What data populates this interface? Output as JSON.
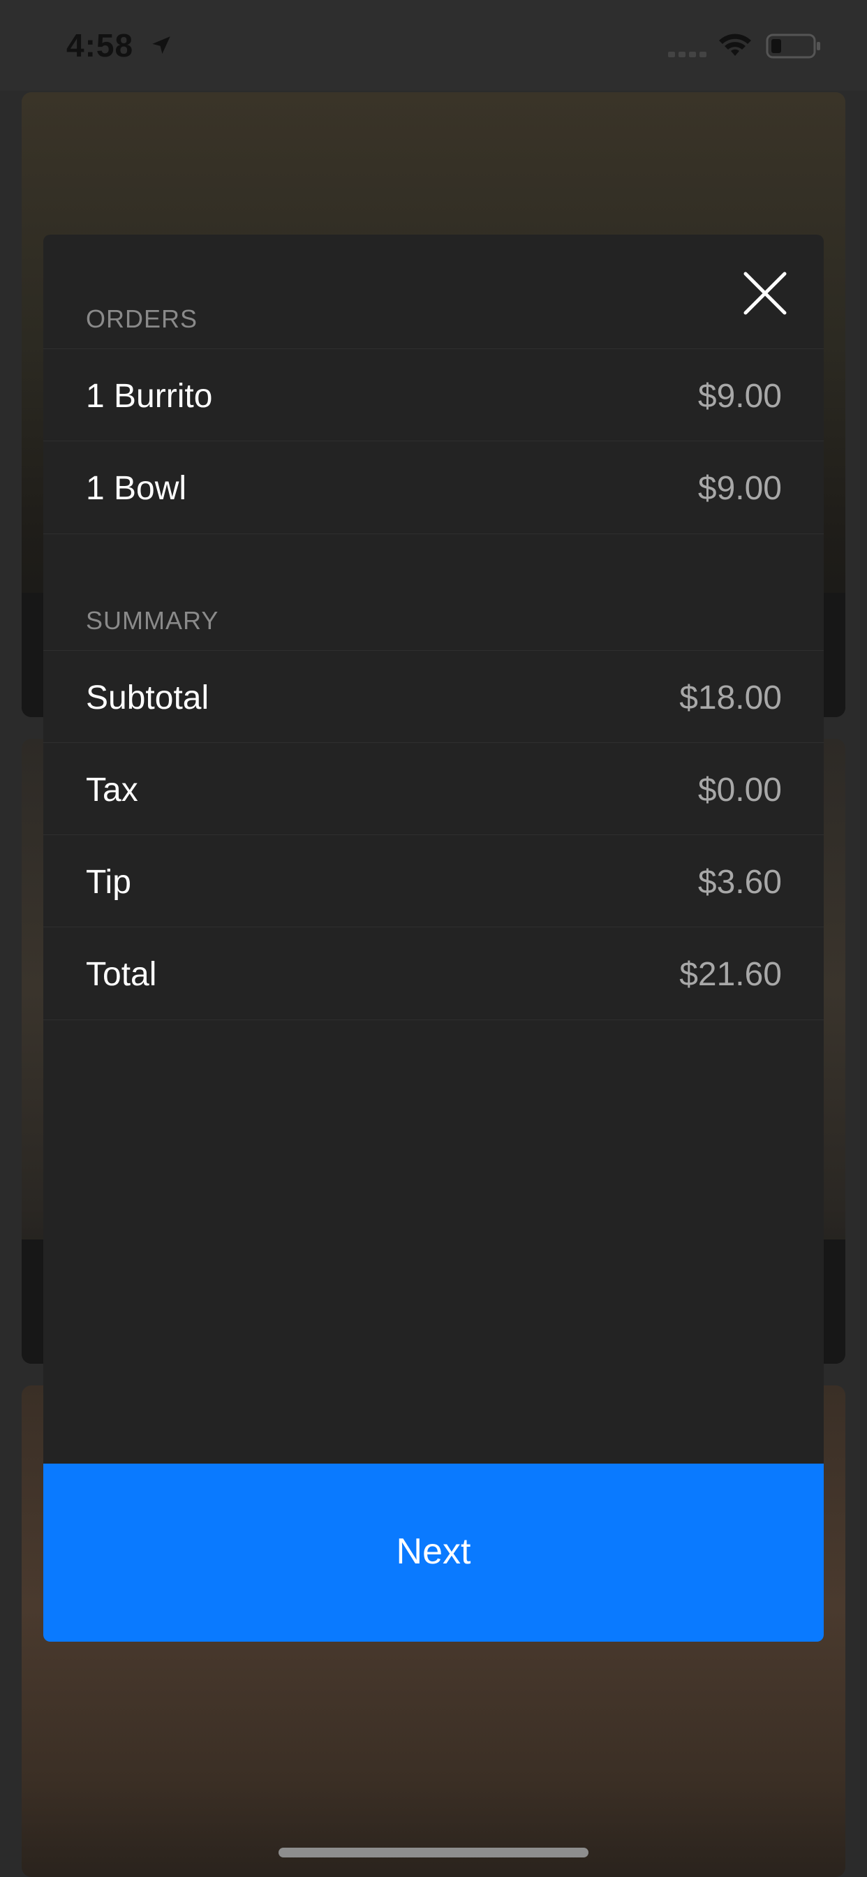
{
  "status_bar": {
    "time": "4:58",
    "icons": [
      "location-arrow-icon",
      "signal-icon",
      "wifi-icon",
      "battery-icon"
    ]
  },
  "modal": {
    "close_icon": "close-icon",
    "orders": {
      "header": "ORDERS",
      "items": [
        {
          "label": "1 Burrito",
          "value": "$9.00"
        },
        {
          "label": "1 Bowl",
          "value": "$9.00"
        }
      ]
    },
    "summary": {
      "header": "SUMMARY",
      "items": [
        {
          "label": "Subtotal",
          "value": "$18.00"
        },
        {
          "label": "Tax",
          "value": "$0.00"
        },
        {
          "label": "Tip",
          "value": "$3.60"
        },
        {
          "label": "Total",
          "value": "$21.60"
        }
      ]
    },
    "next_label": "Next"
  },
  "colors": {
    "accent": "#0a7aff",
    "modal_bg": "#232323",
    "muted_text": "#8a8a8a"
  }
}
